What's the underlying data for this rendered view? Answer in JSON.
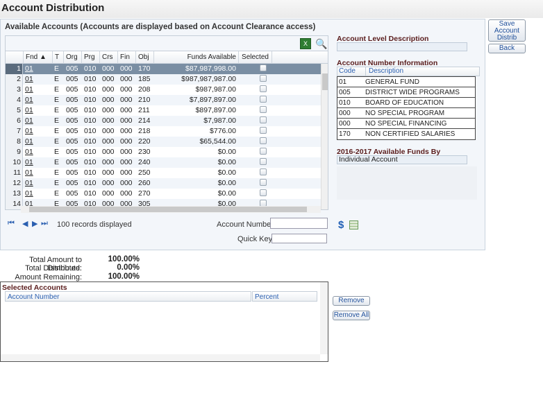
{
  "page": {
    "title": "Account Distribution"
  },
  "available": {
    "header": "Available Accounts (Accounts are displayed based on Account Clearance access)",
    "export_glyph": "X",
    "print_glyph": "🔍",
    "columns": {
      "fnd": "Fnd ▲",
      "t": "T",
      "org": "Org",
      "prg": "Prg",
      "crs": "Crs",
      "fin": "Fin",
      "obj": "Obj",
      "funds": "Funds Available",
      "selected": "Selected"
    },
    "rows": [
      {
        "n": "1",
        "fnd": "01",
        "t": "E",
        "org": "005",
        "prg": "010",
        "crs": "000",
        "fin": "000",
        "obj": "170",
        "funds": "$87,987,998.00",
        "selected": false
      },
      {
        "n": "2",
        "fnd": "01",
        "t": "E",
        "org": "005",
        "prg": "010",
        "crs": "000",
        "fin": "000",
        "obj": "185",
        "funds": "$987,987,987.00",
        "selected": false
      },
      {
        "n": "3",
        "fnd": "01",
        "t": "E",
        "org": "005",
        "prg": "010",
        "crs": "000",
        "fin": "000",
        "obj": "208",
        "funds": "$987,987.00",
        "selected": false
      },
      {
        "n": "4",
        "fnd": "01",
        "t": "E",
        "org": "005",
        "prg": "010",
        "crs": "000",
        "fin": "000",
        "obj": "210",
        "funds": "$7,897,897.00",
        "selected": false
      },
      {
        "n": "5",
        "fnd": "01",
        "t": "E",
        "org": "005",
        "prg": "010",
        "crs": "000",
        "fin": "000",
        "obj": "211",
        "funds": "$897,897.00",
        "selected": false
      },
      {
        "n": "6",
        "fnd": "01",
        "t": "E",
        "org": "005",
        "prg": "010",
        "crs": "000",
        "fin": "000",
        "obj": "214",
        "funds": "$7,987.00",
        "selected": false
      },
      {
        "n": "7",
        "fnd": "01",
        "t": "E",
        "org": "005",
        "prg": "010",
        "crs": "000",
        "fin": "000",
        "obj": "218",
        "funds": "$776.00",
        "selected": false
      },
      {
        "n": "8",
        "fnd": "01",
        "t": "E",
        "org": "005",
        "prg": "010",
        "crs": "000",
        "fin": "000",
        "obj": "220",
        "funds": "$65,544.00",
        "selected": false
      },
      {
        "n": "9",
        "fnd": "01",
        "t": "E",
        "org": "005",
        "prg": "010",
        "crs": "000",
        "fin": "000",
        "obj": "230",
        "funds": "$0.00",
        "selected": false
      },
      {
        "n": "10",
        "fnd": "01",
        "t": "E",
        "org": "005",
        "prg": "010",
        "crs": "000",
        "fin": "000",
        "obj": "240",
        "funds": "$0.00",
        "selected": false
      },
      {
        "n": "11",
        "fnd": "01",
        "t": "E",
        "org": "005",
        "prg": "010",
        "crs": "000",
        "fin": "000",
        "obj": "250",
        "funds": "$0.00",
        "selected": false
      },
      {
        "n": "12",
        "fnd": "01",
        "t": "E",
        "org": "005",
        "prg": "010",
        "crs": "000",
        "fin": "000",
        "obj": "260",
        "funds": "$0.00",
        "selected": false
      },
      {
        "n": "13",
        "fnd": "01",
        "t": "E",
        "org": "005",
        "prg": "010",
        "crs": "000",
        "fin": "000",
        "obj": "270",
        "funds": "$0.00",
        "selected": false
      },
      {
        "n": "14",
        "fnd": "01",
        "t": "E",
        "org": "005",
        "prg": "010",
        "crs": "000",
        "fin": "000",
        "obj": "305",
        "funds": "$0.00",
        "selected": false
      }
    ],
    "pager": {
      "first": "⏮",
      "prev": "◀",
      "next": "▶",
      "last": "⏭",
      "records_text": "100 records displayed"
    },
    "account_number_label": "Account Number:",
    "account_number_value": "",
    "quick_key_label": "Quick Key:",
    "quick_key_value": "",
    "dollar_glyph": "$"
  },
  "right_panel": {
    "level_desc_title": "Account Level Description",
    "level_desc_value": "",
    "num_info_title": "Account Number Information",
    "code_header": "Code",
    "desc_header": "Description",
    "items": [
      {
        "code": "01",
        "desc": "GENERAL FUND"
      },
      {
        "code": "005",
        "desc": "DISTRICT WIDE PROGRAMS"
      },
      {
        "code": "010",
        "desc": "BOARD OF EDUCATION"
      },
      {
        "code": "000",
        "desc": "NO SPECIAL PROGRAM"
      },
      {
        "code": "000",
        "desc": "NO SPECIAL FINANCING"
      },
      {
        "code": "170",
        "desc": "NON CERTIFIED SALARIES"
      }
    ],
    "funds_by_title": "2016-2017 Available Funds By",
    "funds_by_value": "Individual Account"
  },
  "buttons": {
    "save_line1": "Save",
    "save_line2": "Account",
    "save_line3": "Distrib",
    "back": "Back",
    "remove": "Remove",
    "remove_all": "Remove All"
  },
  "totals": {
    "total_to_distribute_label": "Total Amount to Distribute:",
    "total_to_distribute_value": "100.00%",
    "total_distributed_label": "Total Distributed:",
    "total_distributed_value": "0.00%",
    "remaining_label": "Amount Remaining:",
    "remaining_value": "100.00%"
  },
  "selected_accounts": {
    "title": "Selected Accounts",
    "col_account": "Account Number",
    "col_percent": "Percent"
  }
}
